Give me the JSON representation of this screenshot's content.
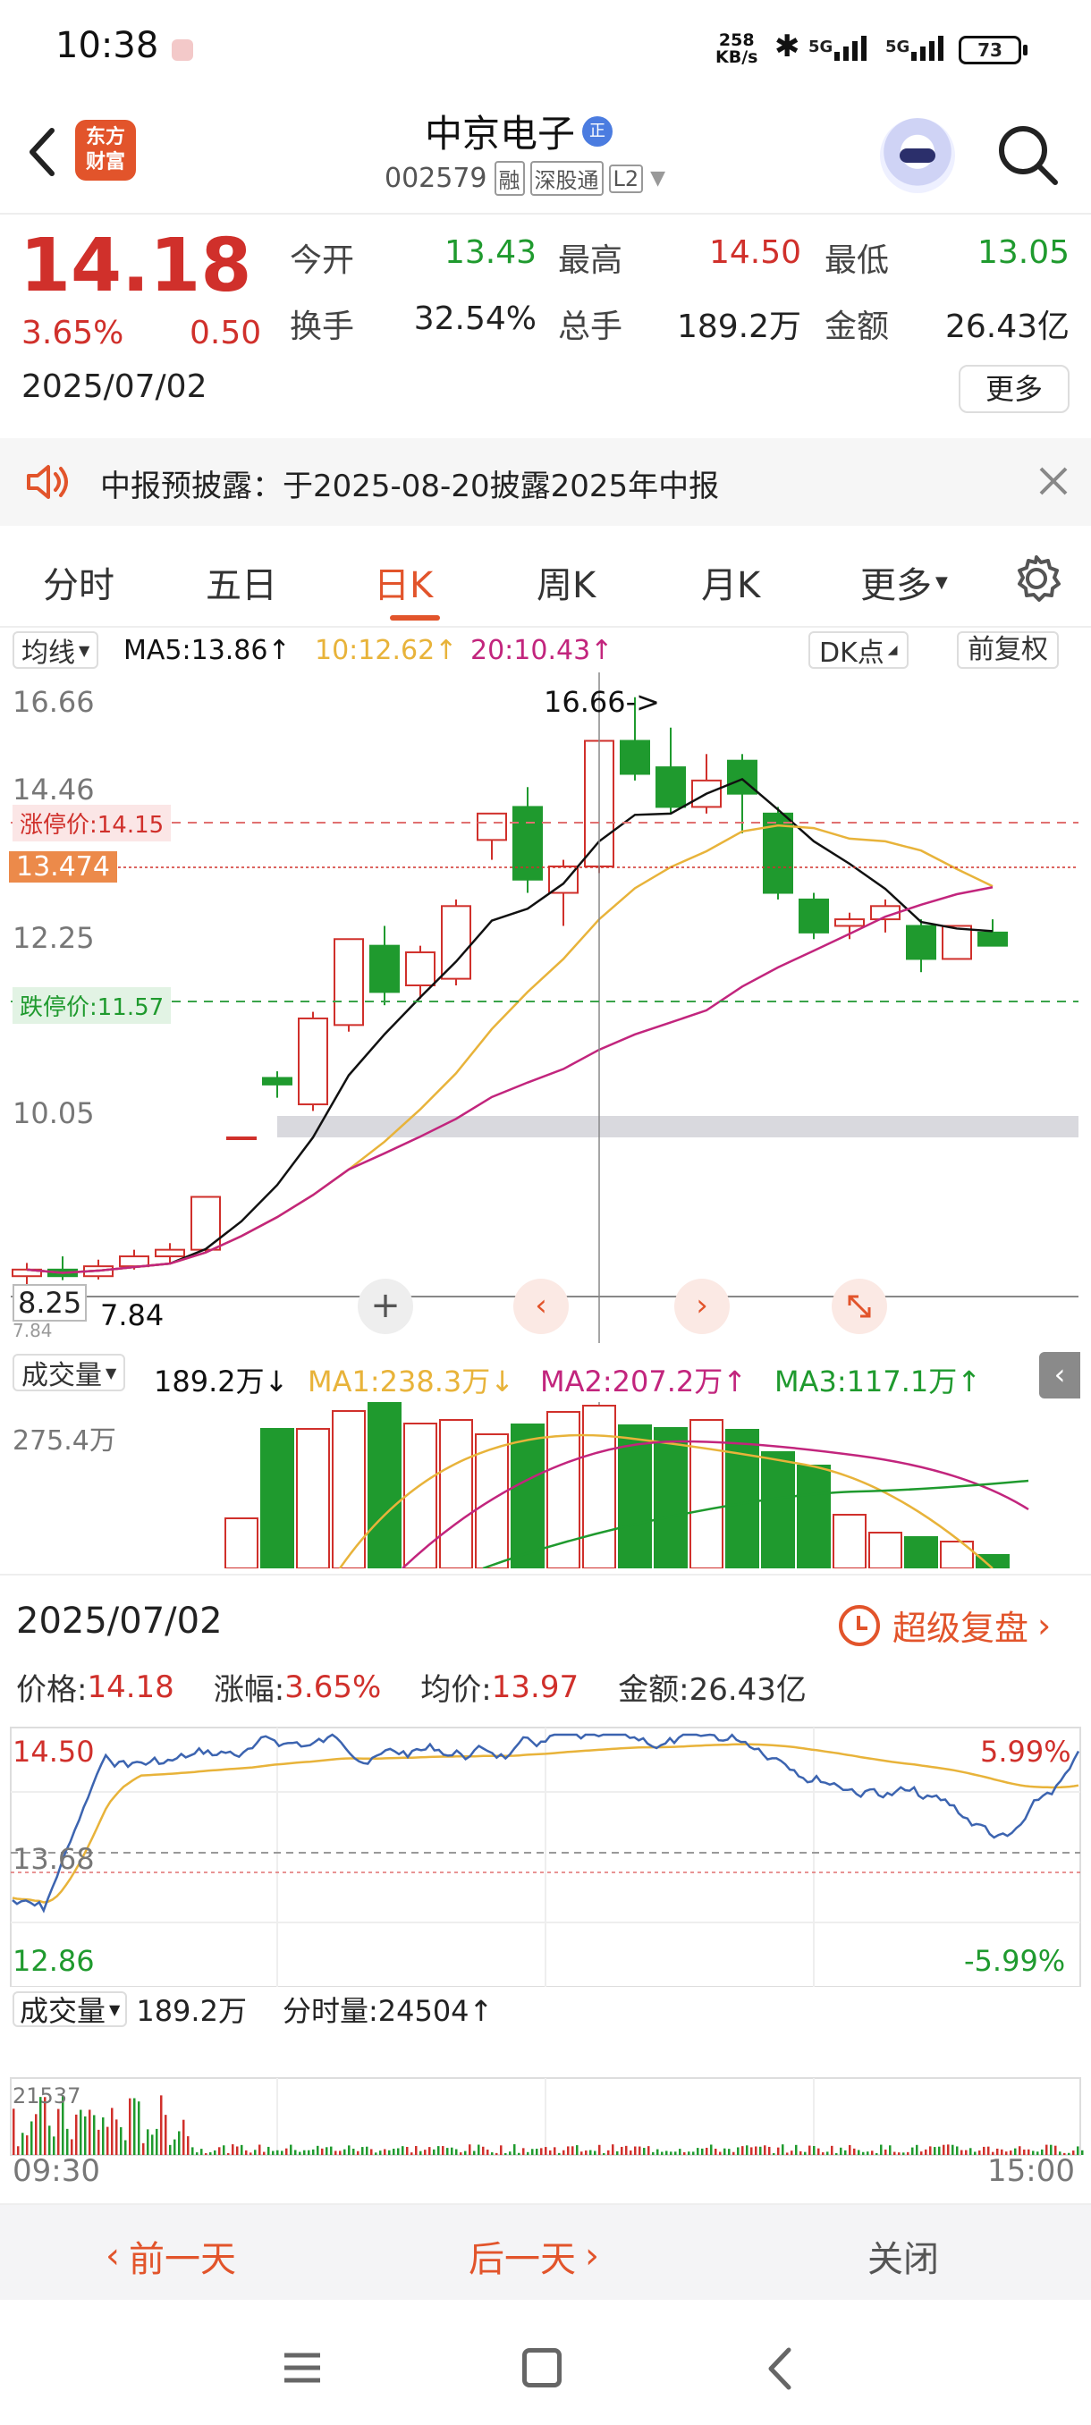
{
  "status": {
    "time": "10:38",
    "net_speed_top": "258",
    "net_speed_bottom": "KB/s",
    "sig1": "5G",
    "sig2": "5G",
    "battery": "73"
  },
  "header": {
    "brand_line1": "东方",
    "brand_line2": "财富",
    "name": "中京电子",
    "name_badge": "正",
    "code": "002579",
    "tags": [
      "融",
      "深股通",
      "L2"
    ]
  },
  "quote": {
    "price": "14.18",
    "change_pct": "3.65%",
    "change": "0.50",
    "date": "2025/07/02",
    "stats": [
      {
        "label": "今开",
        "value": "13.43",
        "color": "green"
      },
      {
        "label": "最高",
        "value": "14.50",
        "color": "red"
      },
      {
        "label": "最低",
        "value": "13.05",
        "color": "green"
      },
      {
        "label": "换手",
        "value": "32.54%",
        "color": "dark"
      },
      {
        "label": "总手",
        "value": "189.2万",
        "color": "dark"
      },
      {
        "label": "金额",
        "value": "26.43亿",
        "color": "dark"
      }
    ],
    "more_label": "更多"
  },
  "notice": {
    "text": "中报预披露：于2025-08-20披露2025年中报"
  },
  "tabs": {
    "items": [
      "分时",
      "五日",
      "日K",
      "周K",
      "月K",
      "更多"
    ],
    "active": 2
  },
  "kline": {
    "ma_selector": "均线",
    "ma5": "MA5:13.86↑",
    "ma10": "10:12.62↑",
    "ma20": "20:10.43↑",
    "dk_label": "DK点",
    "adjust_label": "前复权",
    "y_labels": [
      "16.66",
      "14.46",
      "12.25",
      "10.05",
      "8.25"
    ],
    "limit_up": "涨停价:14.15",
    "limit_down": "跌停价:11.57",
    "cursor_price": "13.474",
    "high_note": "16.66->",
    "low_note": "7.84",
    "low_note2": "7.84"
  },
  "volume": {
    "selector": "成交量",
    "value": "189.2万↓",
    "ma1": "MA1:238.3万↓",
    "ma2": "MA2:207.2万↑",
    "ma3": "MA3:117.1万↑",
    "y_top": "275.4万"
  },
  "replay": {
    "date": "2025/07/02",
    "super_label": "超级复盘",
    "price_label": "价格:",
    "price": "14.18",
    "change_label": "涨幅:",
    "change": "3.65%",
    "avg_label": "均价:",
    "avg": "13.97",
    "amount_label": "金额:",
    "amount": "26.43亿",
    "y_high": "14.50",
    "y_mid": "13.68",
    "y_low": "12.86",
    "pct_high": "5.99%",
    "pct_low": "-5.99%",
    "vol_selector": "成交量",
    "vol_value": "189.2万",
    "tick_vol": "分时量:24504↑",
    "vol_max": "21537",
    "t_start": "09:30",
    "t_end": "15:00"
  },
  "footer": {
    "prev": "前一天",
    "next": "后一天",
    "close": "关闭"
  },
  "colors": {
    "up": "#d0302b",
    "down": "#1f9a2e",
    "ma5": "#111111",
    "ma10": "#e8b33a",
    "ma20": "#c2257d",
    "accent": "#e2542b"
  },
  "chart_data": {
    "type": "candlestick",
    "ohlc": [
      [
        7.9,
        8.1,
        7.75,
        8.0
      ],
      [
        8.0,
        8.2,
        7.84,
        7.9
      ],
      [
        7.9,
        8.15,
        7.85,
        8.05
      ],
      [
        8.05,
        8.3,
        8.0,
        8.2
      ],
      [
        8.2,
        8.4,
        8.1,
        8.3
      ],
      [
        8.3,
        9.1,
        8.25,
        9.1
      ],
      [
        10.0,
        10.0,
        10.0,
        10.0
      ],
      [
        10.9,
        11.0,
        10.6,
        10.8
      ],
      [
        10.5,
        11.9,
        10.4,
        11.8
      ],
      [
        11.7,
        13.0,
        11.6,
        13.0
      ],
      [
        12.9,
        13.2,
        12.0,
        12.2
      ],
      [
        12.3,
        12.9,
        12.1,
        12.8
      ],
      [
        12.4,
        13.6,
        12.3,
        13.5
      ],
      [
        14.5,
        14.9,
        14.2,
        14.9
      ],
      [
        15.0,
        15.3,
        13.7,
        13.9
      ],
      [
        13.7,
        14.2,
        13.2,
        14.1
      ],
      [
        14.1,
        16.0,
        14.0,
        16.0
      ],
      [
        16.0,
        16.66,
        15.4,
        15.5
      ],
      [
        15.6,
        16.2,
        14.9,
        15.0
      ],
      [
        15.0,
        15.8,
        14.9,
        15.4
      ],
      [
        15.7,
        15.8,
        14.6,
        15.2
      ],
      [
        14.9,
        15.0,
        13.6,
        13.7
      ],
      [
        13.6,
        13.7,
        13.0,
        13.1
      ],
      [
        13.2,
        13.4,
        13.0,
        13.3
      ],
      [
        13.3,
        13.6,
        13.1,
        13.5
      ],
      [
        13.2,
        13.3,
        12.5,
        12.7
      ],
      [
        12.7,
        13.2,
        12.7,
        13.2
      ],
      [
        13.1,
        13.3,
        13.0,
        12.9
      ]
    ],
    "volume": [
      56,
      156,
      156,
      176,
      185,
      162,
      166,
      150,
      161,
      175,
      182,
      160,
      157,
      166,
      155,
      130,
      115,
      60,
      40,
      35,
      30,
      15
    ],
    "ylim": [
      7.84,
      16.66
    ]
  }
}
